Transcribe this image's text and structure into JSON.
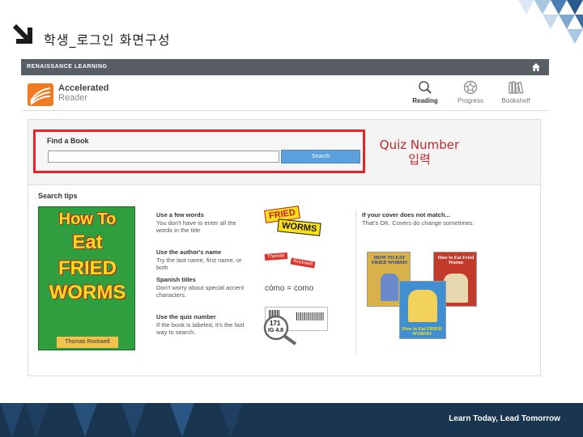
{
  "slide": {
    "title": "학생_로그인 화면구성",
    "footer": "Learn Today, Lead Tomorrow"
  },
  "topbar": {
    "brand": "RENAISSANCE LEARNING"
  },
  "app": {
    "name_line1": "Accelerated",
    "name_line2": "Reader",
    "nav": [
      {
        "label": "Reading",
        "icon": "magnifier-icon",
        "active": true
      },
      {
        "label": "Progress",
        "icon": "star-badge-icon",
        "active": false
      },
      {
        "label": "Bookshelf",
        "icon": "books-icon",
        "active": false
      }
    ]
  },
  "find": {
    "title": "Find a Book",
    "input_value": "",
    "button_label": "Search"
  },
  "annotation": {
    "line1": "Quiz Number",
    "line2": "입력"
  },
  "tips": {
    "title": "Search tips",
    "book": {
      "title_line1": "How To",
      "title_line2": "Eat",
      "title_line3": "FRIED",
      "title_line4": "WORMS",
      "author": "Thomas Rockwell"
    },
    "items": [
      {
        "heading": "Use a few words",
        "body": "You don't have to enter all the words in the title"
      },
      {
        "heading": "Use the author's name",
        "body": "Try the last name, first name, or both"
      },
      {
        "heading": "Spanish titles",
        "body": "Don't worry about special accent characters."
      },
      {
        "heading": "Use the quiz number",
        "body": "If the book is labeled, it's the fast way to search."
      }
    ],
    "examples": {
      "fried": "FRIED",
      "worms": "WORMS",
      "author_first": "Thomas",
      "author_last": "Rockwell",
      "como": "cómo = como",
      "quiz_num": "171",
      "quiz_level": "IG 4.8"
    },
    "cover_tip": {
      "heading": "If your cover does not match...",
      "body": "That's OK. Covers do change sometimes."
    },
    "covers": [
      {
        "title": "HOW TO EAT FRIED WORMS",
        "color": "#d8b24a"
      },
      {
        "title": "How to Eat Fried Worms",
        "color": "#c23b2a"
      },
      {
        "title": "How to Eat FRIED WORMS",
        "color": "#3f8fd2"
      }
    ]
  },
  "colors": {
    "highlight": "#e8232a",
    "annotation": "#c0282e",
    "search_button": "#5aa0dd",
    "topbar": "#585f64",
    "footer": "#1a3550"
  }
}
